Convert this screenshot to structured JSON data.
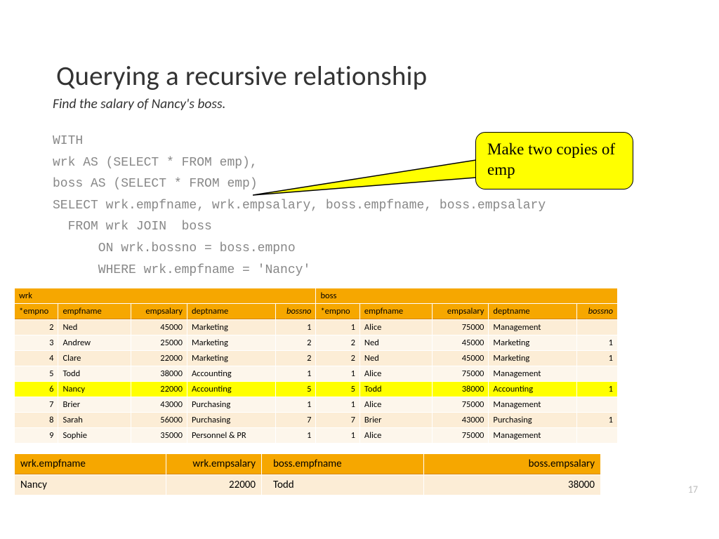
{
  "title": "Querying a recursive relationship",
  "subtitle": "Find the salary  of Nancy's boss.",
  "code": "WITH\nwrk AS (SELECT * FROM emp),\nboss AS (SELECT * FROM emp)\nSELECT wrk.empfname, wrk.empsalary, boss.empfname, boss.empsalary\n  FROM wrk JOIN  boss\n      ON wrk.bossno = boss.empno\n      WHERE wrk.empfname = 'Nancy'",
  "callout": "Make two copies of emp",
  "page_number": "17",
  "join": {
    "group_headers": [
      "wrk",
      "boss"
    ],
    "cols": [
      "*empno",
      "empfname",
      "empsalary",
      "deptname",
      "bossno",
      "*empno",
      "empfname",
      "empsalary",
      "deptname",
      "bossno"
    ],
    "rows": [
      {
        "hl": false,
        "c": [
          "2",
          "Ned",
          "45000",
          "Marketing",
          "1",
          "1",
          "Alice",
          "75000",
          "Management",
          ""
        ]
      },
      {
        "hl": false,
        "c": [
          "3",
          "Andrew",
          "25000",
          "Marketing",
          "2",
          "2",
          "Ned",
          "45000",
          "Marketing",
          "1"
        ]
      },
      {
        "hl": false,
        "c": [
          "4",
          "Clare",
          "22000",
          "Marketing",
          "2",
          "2",
          "Ned",
          "45000",
          "Marketing",
          "1"
        ]
      },
      {
        "hl": false,
        "c": [
          "5",
          "Todd",
          "38000",
          "Accounting",
          "1",
          "1",
          "Alice",
          "75000",
          "Management",
          ""
        ]
      },
      {
        "hl": true,
        "c": [
          "6",
          "Nancy",
          "22000",
          "Accounting",
          "5",
          "5",
          "Todd",
          "38000",
          "Accounting",
          "1"
        ]
      },
      {
        "hl": false,
        "c": [
          "7",
          "Brier",
          "43000",
          "Purchasing",
          "1",
          "1",
          "Alice",
          "75000",
          "Management",
          ""
        ]
      },
      {
        "hl": false,
        "c": [
          "8",
          "Sarah",
          "56000",
          "Purchasing",
          "7",
          "7",
          "Brier",
          "43000",
          "Purchasing",
          "1"
        ]
      },
      {
        "hl": false,
        "c": [
          "9",
          "Sophie",
          "35000",
          "Personnel & PR",
          "1",
          "1",
          "Alice",
          "75000",
          "Management",
          ""
        ]
      }
    ]
  },
  "result": {
    "cols": [
      "wrk.empfname",
      "wrk.empsalary",
      "boss.empfname",
      "boss.empsalary"
    ],
    "row": [
      "Nancy",
      "22000",
      "Todd",
      "38000"
    ]
  }
}
